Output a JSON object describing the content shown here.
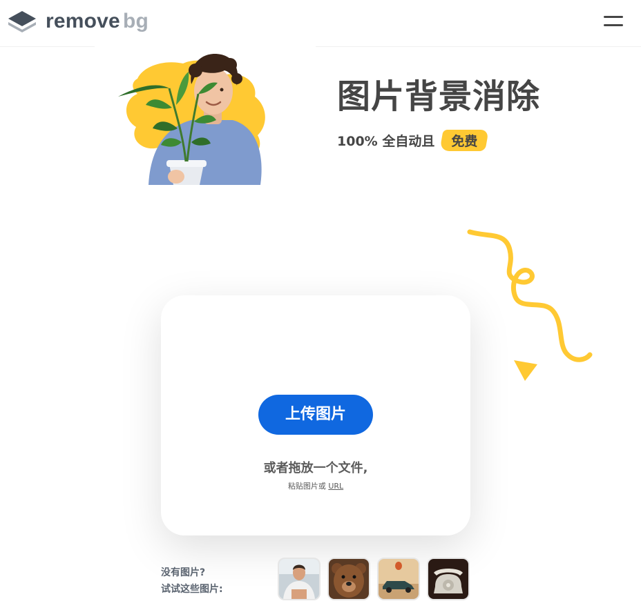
{
  "header": {
    "logo": {
      "word_main": "remove",
      "word_accent": "bg"
    },
    "menu_icon": "hamburger-menu-icon"
  },
  "hero": {
    "title": "图片背景消除",
    "subtitle": "100% 全自动且",
    "badge": "免费"
  },
  "upload": {
    "button_label": "上传图片",
    "drop_text": "或者拖放一个文件,",
    "paste_prefix": "粘贴图片或 ",
    "paste_link": "URL"
  },
  "samples": {
    "line1": "没有图片?",
    "line2": "试试这些图片:",
    "items": [
      "person-thumbnail",
      "bear-thumbnail",
      "car-thumbnail",
      "telephone-thumbnail"
    ]
  },
  "colors": {
    "accent_blue": "#1068e0",
    "accent_yellow": "#ffc933",
    "text_dark": "#454545",
    "logo_gray": "#454f5b",
    "logo_light": "#a7aeb6"
  }
}
